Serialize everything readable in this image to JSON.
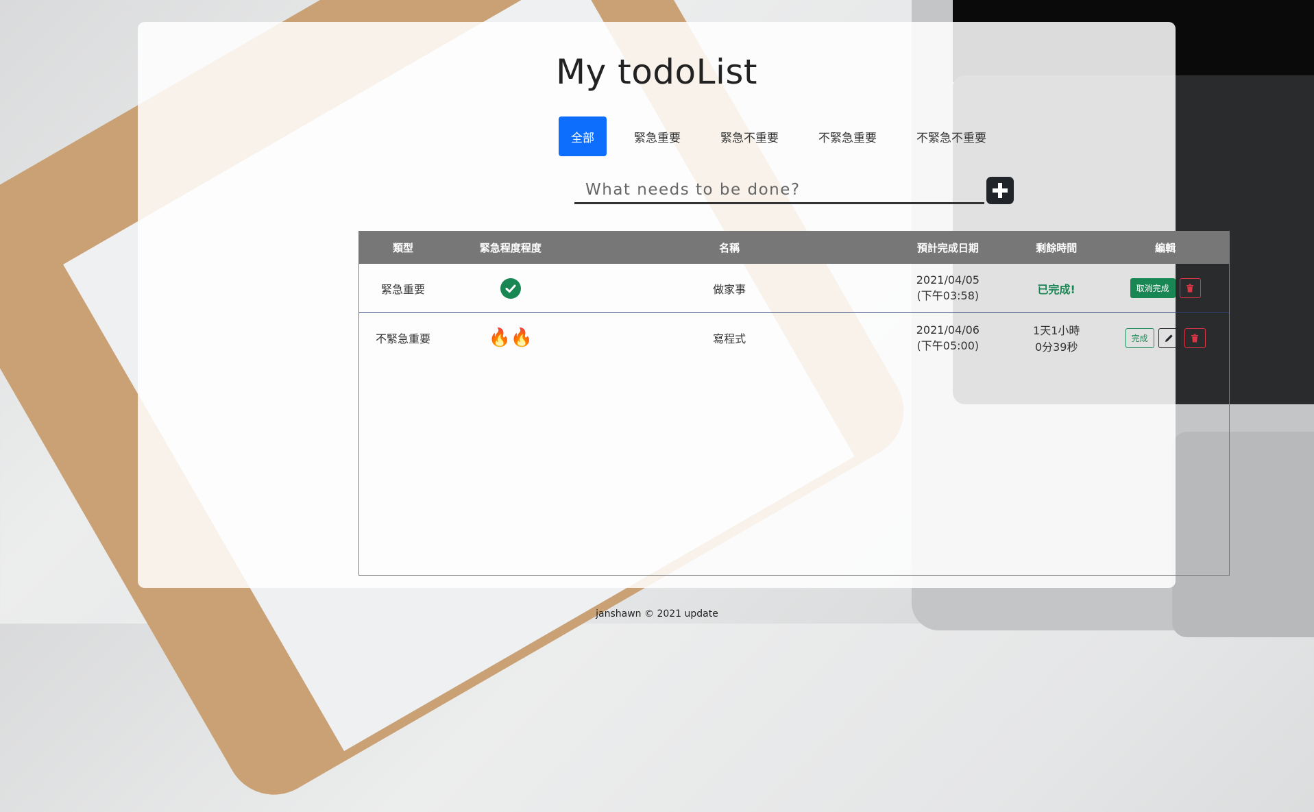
{
  "header": {
    "title": "My todoList"
  },
  "tabs": [
    {
      "label": "全部",
      "active": true
    },
    {
      "label": "緊急重要",
      "active": false
    },
    {
      "label": "緊急不重要",
      "active": false
    },
    {
      "label": "不緊急重要",
      "active": false
    },
    {
      "label": "不緊急不重要",
      "active": false
    }
  ],
  "new_todo": {
    "placeholder": "What needs to be done?",
    "value": ""
  },
  "table": {
    "headers": {
      "type": "類型",
      "level": "緊急程度程度",
      "name": "名稱",
      "date": "預計完成日期",
      "remaining": "剩餘時間",
      "edit": "編輯"
    },
    "rows": [
      {
        "type": "緊急重要",
        "status_icon": "check-circle-icon",
        "name": "做家事",
        "date": "2021/04/05",
        "time": "(下午03:58)",
        "remaining": "已完成!",
        "action_label": "取消完成"
      },
      {
        "type": "不緊急重要",
        "fire_count": 2,
        "name": "寫程式",
        "date": "2021/04/06",
        "time": "(下午05:00)",
        "remaining_line1": "1天1小時",
        "remaining_line2": "0分39秒",
        "action_label": "完成"
      }
    ]
  },
  "colors": {
    "primary": "#0d6efd",
    "success": "#198754",
    "danger": "#dc3545",
    "header_gray": "#777777"
  },
  "footer": {
    "text": "janshawn © 2021 update"
  }
}
